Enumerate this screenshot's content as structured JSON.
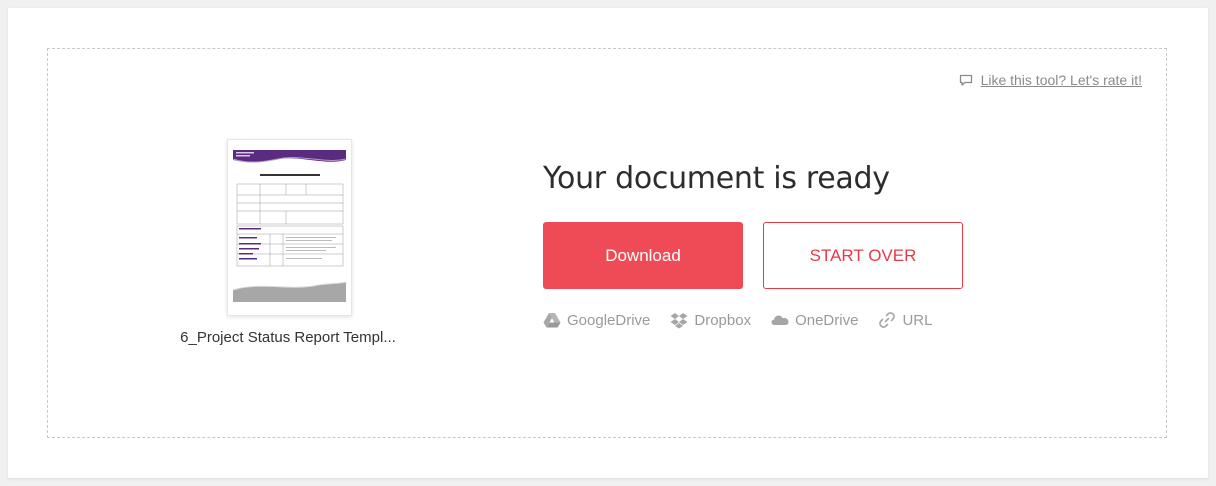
{
  "rate_link": "Like this tool? Let's rate it!",
  "file": {
    "name": "6_Project Status Report Templ..."
  },
  "result": {
    "title": "Your document is ready"
  },
  "buttons": {
    "download": "Download",
    "start_over": "START OVER"
  },
  "services": [
    {
      "label": "GoogleDrive",
      "icon": "google-drive-icon"
    },
    {
      "label": "Dropbox",
      "icon": "dropbox-icon"
    },
    {
      "label": "OneDrive",
      "icon": "onedrive-icon"
    },
    {
      "label": "URL",
      "icon": "link-icon"
    }
  ],
  "colors": {
    "accent": "#ef4b56",
    "outline": "#e43b47",
    "muted": "#9a9a9a"
  }
}
